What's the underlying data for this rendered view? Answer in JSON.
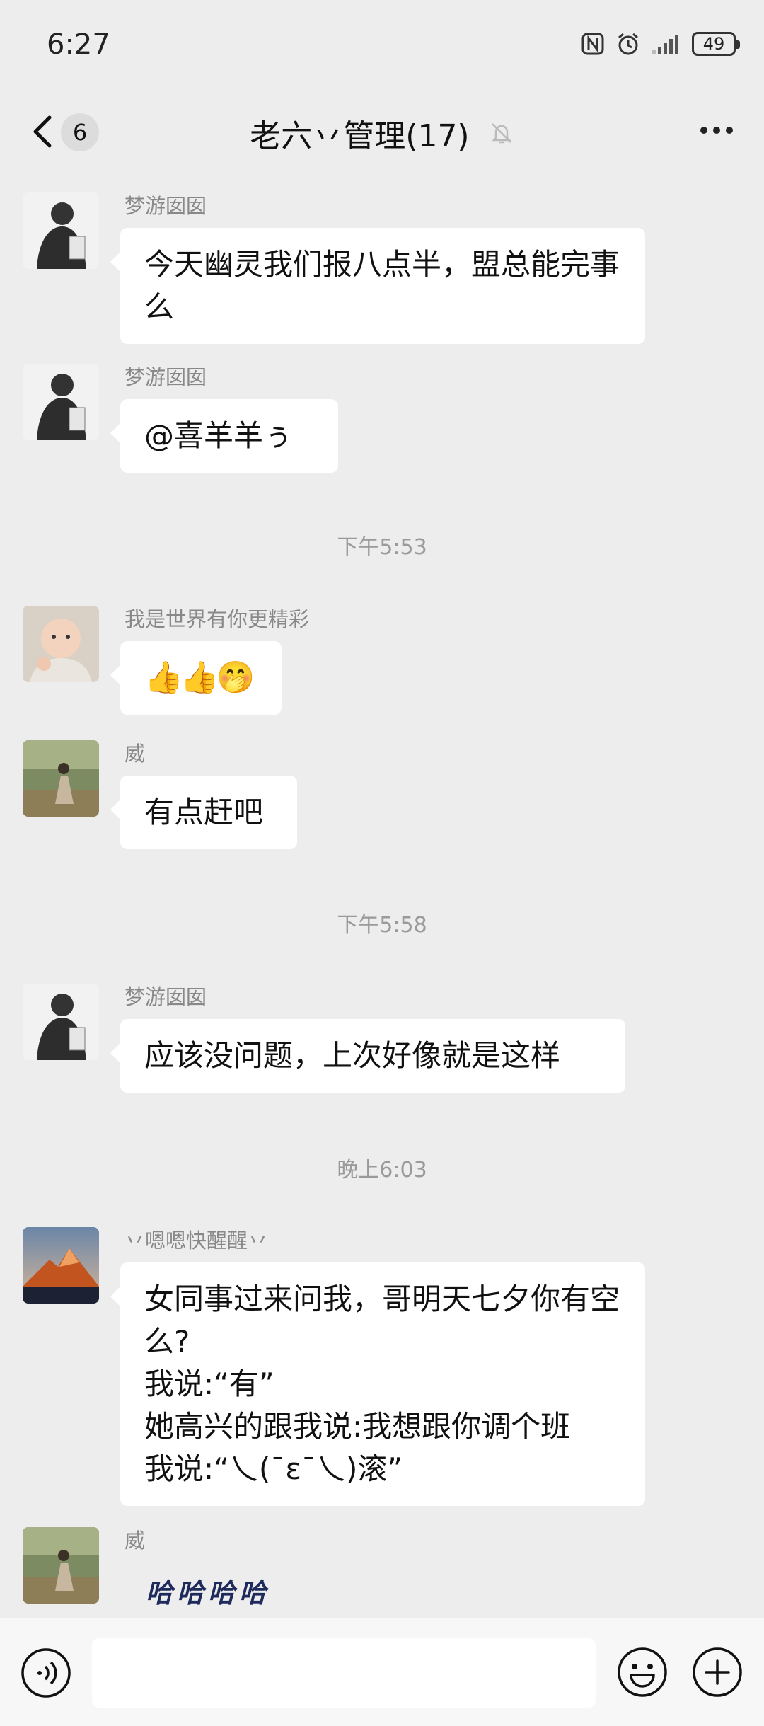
{
  "status_bar": {
    "time": "6:27",
    "battery": "49"
  },
  "header": {
    "back_count": "6",
    "title": "老六丷管理(17)"
  },
  "messages": [
    {
      "sender": "梦游囡囡",
      "text": "今天幽灵我们报八点半，盟总能完事么"
    },
    {
      "sender": "梦游囡囡",
      "text": "@喜羊羊ぅ"
    },
    {
      "sender": "我是世界有你更精彩",
      "emojis": [
        "👍",
        "👍",
        "🤭"
      ]
    },
    {
      "sender": "威",
      "text": "有点赶吧"
    },
    {
      "sender": "梦游囡囡",
      "text": "应该没问题，上次好像就是这样"
    },
    {
      "sender": "丷嗯嗯快醒醒丷",
      "text": "女同事过来问我，哥明天七夕你有空么?\n我说:“有”\n她高兴的跟我说:我想跟你调个班\n我说:“乀(ˉεˉ乀)滚”"
    },
    {
      "sender": "威",
      "sticker": "哈哈哈哈"
    }
  ],
  "timestamps": [
    "下午5:53",
    "下午5:58",
    "晚上6:03"
  ],
  "input": {
    "value": ""
  }
}
